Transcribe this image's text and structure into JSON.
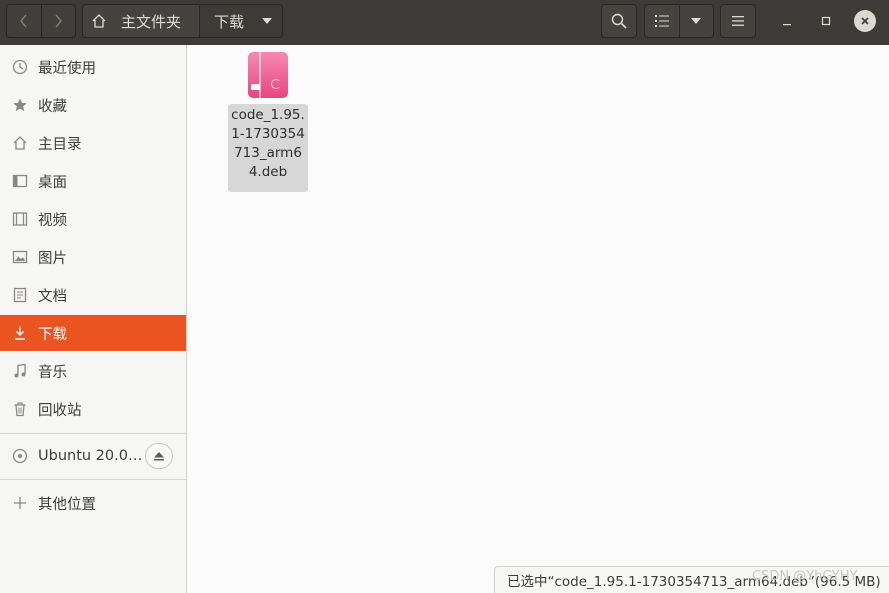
{
  "header": {
    "path_home": "主文件夹",
    "path_current": "下载"
  },
  "sidebar": {
    "items": [
      {
        "label": "最近使用",
        "icon": "clock-icon"
      },
      {
        "label": "收藏",
        "icon": "star-icon"
      },
      {
        "label": "主目录",
        "icon": "home-icon"
      },
      {
        "label": "桌面",
        "icon": "desktop-icon"
      },
      {
        "label": "视频",
        "icon": "video-icon"
      },
      {
        "label": "图片",
        "icon": "picture-icon"
      },
      {
        "label": "文档",
        "icon": "document-icon"
      },
      {
        "label": "下载",
        "icon": "download-icon",
        "active": true
      },
      {
        "label": "音乐",
        "icon": "music-icon"
      },
      {
        "label": "回收站",
        "icon": "trash-icon"
      }
    ],
    "device": {
      "label": "Ubuntu 20.0…",
      "icon": "disc-icon"
    },
    "other": {
      "label": "其他位置",
      "icon": "plus-icon"
    }
  },
  "files": [
    {
      "name": "code_1.95.1-1730354713_arm64.deb",
      "icon": "deb-package-icon"
    }
  ],
  "status_bar": "已选中“code_1.95.1-1730354713_arm64.deb”(96.5 MB)",
  "watermark": "CSDN @YhGYHY",
  "colors": {
    "accent": "#e95420",
    "header": "#3c3b37",
    "selection": "#d7d7d7"
  }
}
